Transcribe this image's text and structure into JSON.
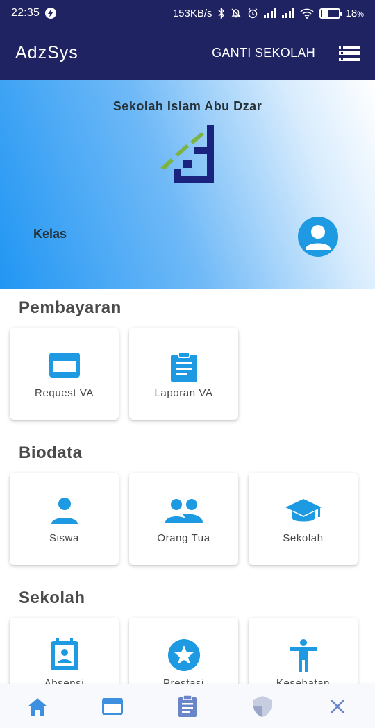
{
  "status_bar": {
    "time": "22:35",
    "network_speed": "153KB/s",
    "battery": "18",
    "battery_unit": "%"
  },
  "app_bar": {
    "title": "AdzSys",
    "action_label": "GANTI SEKOLAH",
    "menu_icon": "list-menu-icon"
  },
  "hero": {
    "school_name": "Sekolah Islam Abu Dzar",
    "class_label": "Kelas",
    "avatar_icon": "user-avatar-icon"
  },
  "sections": {
    "pembayaran": {
      "title": "Pembayaran",
      "items": [
        {
          "label": "Request VA",
          "icon": "credit-card-icon"
        },
        {
          "label": "Laporan VA",
          "icon": "clipboard-icon"
        }
      ]
    },
    "biodata": {
      "title": "Biodata",
      "items": [
        {
          "label": "Siswa",
          "icon": "person-icon"
        },
        {
          "label": "Orang Tua",
          "icon": "people-icon"
        },
        {
          "label": "Sekolah",
          "icon": "graduation-cap-icon"
        }
      ]
    },
    "sekolah": {
      "title": "Sekolah",
      "items": [
        {
          "label": "Absensi",
          "icon": "badge-icon"
        },
        {
          "label": "Prestasi",
          "icon": "star-icon"
        },
        {
          "label": "Kesehatan",
          "icon": "accessibility-icon"
        }
      ]
    }
  },
  "bottom_nav": [
    {
      "icon": "home-icon"
    },
    {
      "icon": "credit-card-icon"
    },
    {
      "icon": "clipboard-icon"
    },
    {
      "icon": "shield-icon"
    },
    {
      "icon": "close-icon"
    }
  ],
  "colors": {
    "header": "#1f2361",
    "accent": "#1e9ae3",
    "nav_home": "#3d8fe0",
    "nav_inactive": "#6a86c9"
  }
}
